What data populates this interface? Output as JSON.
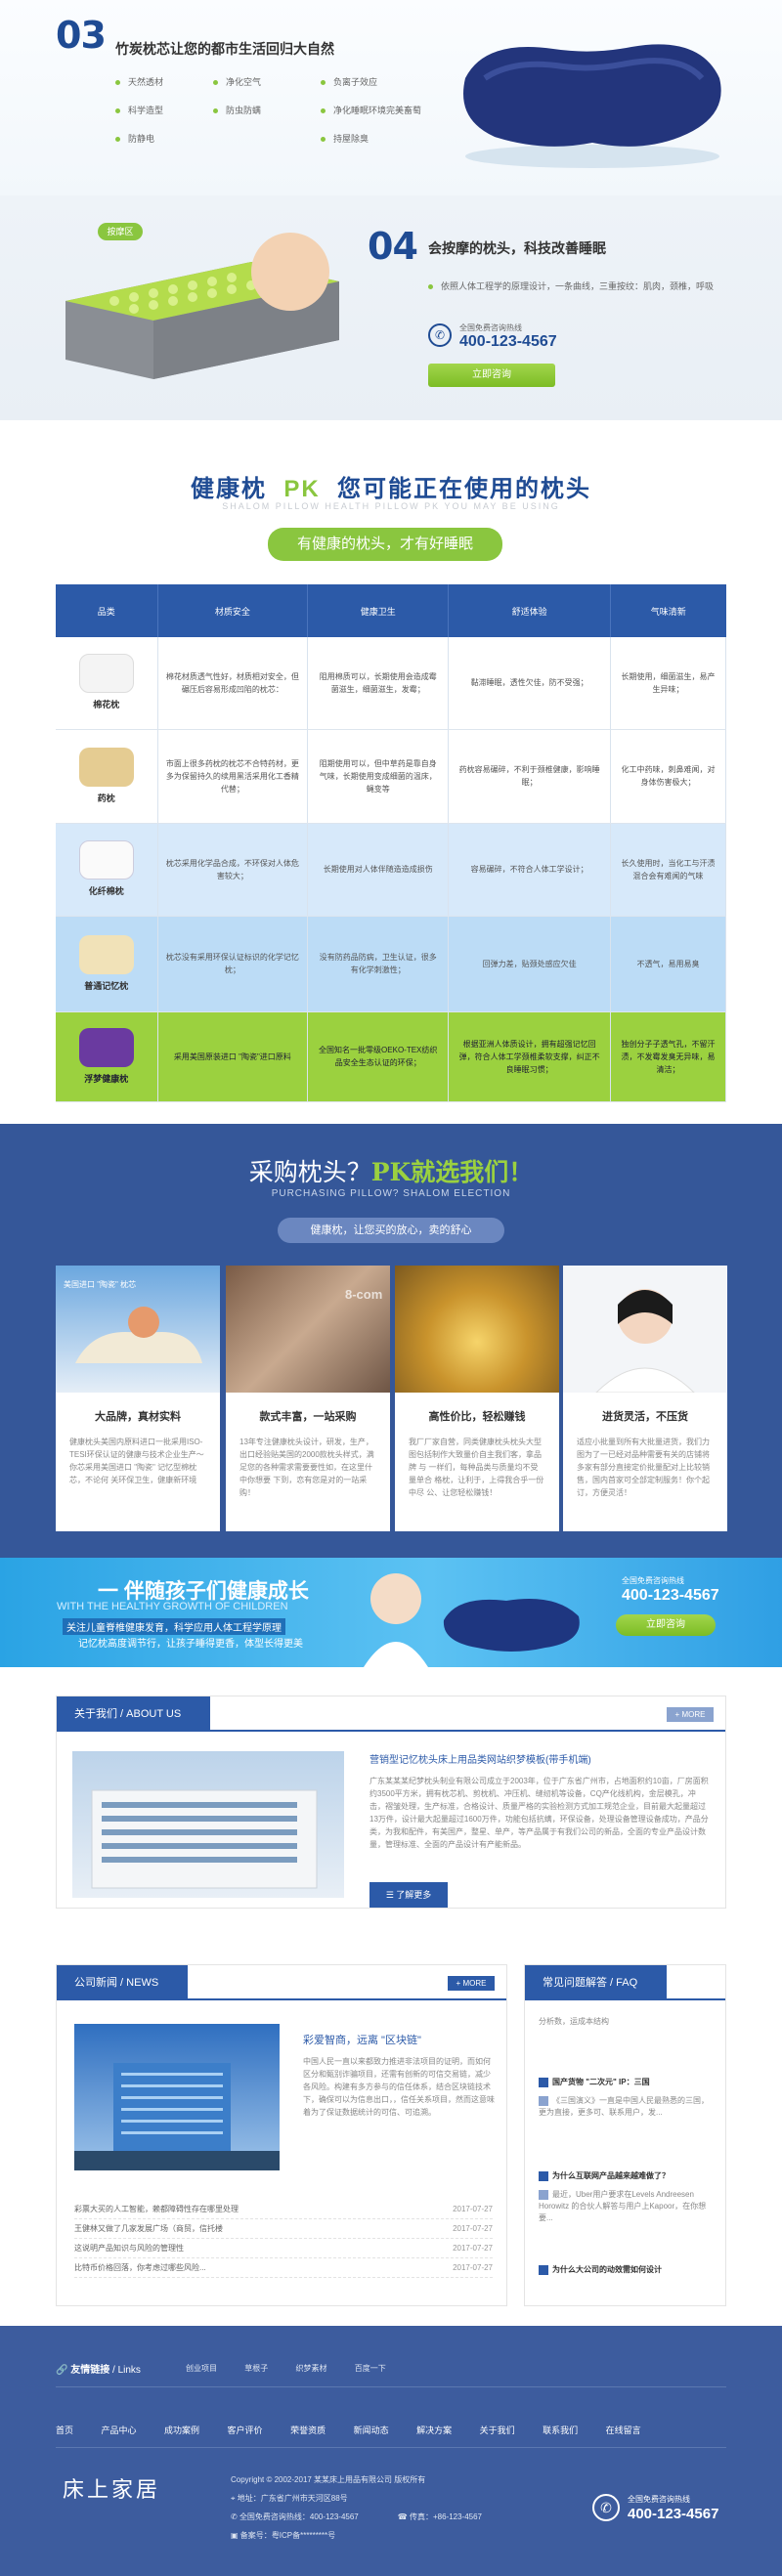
{
  "sec03": {
    "num": "03",
    "title": "竹炭枕芯让您的都市生活回归大自然",
    "features": [
      [
        "天然透材",
        "净化空气",
        "负离子效应"
      ],
      [
        "科学造型",
        "防虫防螨",
        "净化睡眠环境完美畜萄"
      ],
      [
        "防静电",
        "",
        "持屋除臭"
      ]
    ]
  },
  "sec04": {
    "badge": "按摩区",
    "num": "04",
    "title": "会按摩的枕头，科技改善睡眠",
    "desc": "依照人体工程学的原理设计，一条曲线，三重按纹：肌肉，颈椎，呼吸",
    "tel_label": "全国免费咨询热线",
    "tel": "400-123-4567",
    "button": "立即咨询"
  },
  "pk": {
    "title_a": "健康枕",
    "title_b": "PK",
    "title_c": "您可能正在使用的枕头",
    "subtitle": "SHALOM PILLOW HEALTH PILLOW PK YOU MAY BE USING",
    "pill": "有健康的枕头，才有好睡眠",
    "headers": [
      "品类",
      "材质安全",
      "健康卫生",
      "舒适体验",
      "气味清新"
    ],
    "rows": [
      {
        "name": "棉花枕",
        "cells": [
          "棉花材质透气性好，材质相对安全，但碾压后容易形成凹陷的枕芯：",
          "阻用棉质可以，长期使用会造成霉菌滋生，细菌滋生，发霉；",
          "黏滞睡眠，透性欠佳，防不受强；",
          "长期使用，细菌滋生，易产生异味；"
        ]
      },
      {
        "name": "药枕",
        "cells": [
          "市面上很多药枕的枕芯不合特药材，更多为保留持久的续用黑活采用化工香精代替；",
          "阻期使用可以，但中草药是靠自身气味，长期使用变成细菌的温床，蝇变等",
          "药枕容易碾碎，不利于颈椎健康，影响睡眠；",
          "化工中药味，刺鼻难闻，对身体伤害极大；"
        ]
      },
      {
        "name": "化纤棉枕",
        "cells": [
          "枕芯采用化学品合成，不环保对人体危害较大；",
          "长期使用对人体伴随造造成损伤",
          "容易碾碎，不符合人体工学设计；",
          "长久使用时，当化工与汗渍混合会有难闻的气味"
        ]
      },
      {
        "name": "普通记忆枕",
        "cells": [
          "枕芯没有采用环保认证标识的化学记忆枕；",
          "没有防药品防病，卫生认证，很多有化学刺激性；",
          "回弹力差，贴颈处感应欠佳",
          "不透气，易用易臭"
        ]
      },
      {
        "name": "浮梦健康枕",
        "cells": [
          "采用美国原装进口 \"陶瓷\"进口原料",
          "全国知名一批零级OEKO-TEX纺织品安全生态认证的环保；",
          "根据亚洲人体质设计，拥有超强记忆回弹，符合人体工学颈椎柔软支撑，纠正不良睡眠习惯；",
          "独创分子子透气孔，不留汗渍，不发霉发臭无异味，易清洁；"
        ]
      }
    ]
  },
  "purchase": {
    "title_a": "采购枕头？",
    "title_b": "PK就选我们！",
    "subtitle": "PURCHASING PILLOW? SHALOM ELECTION",
    "pill": "健康枕，让您买的放心，卖的舒心",
    "watermark": "8-com",
    "cards": [
      {
        "tag": "美国进口 \"陶瓷\" 枕芯",
        "title": "大品牌，真材实料",
        "text": "健康枕头美国内原料进口一批采用ISO-TESI环保认证的健康与技术企业生产～ 你芯采用美国进口 \"陶瓷\" 记忆型棉枕芯，不论何 关环保卫生，健康新环境"
      },
      {
        "tag": "",
        "title": "款式丰富，一站采购",
        "text": "13年专注健康枕头设计，研发，生产，出口经验贴美国的2000款枕头样式，满足您的各种需求需要要性如，在这里什中你想要 下到，恋有您是对的一站采购！"
      },
      {
        "tag": "",
        "title": "高性价比，轻松赚钱",
        "text": "我厂厂家自营，同类健康枕头枕头大型图包括制作大致量价自主我们客，拿品牌 与 一样们，每种品类与质量均不受量单合 格枕，让利于，上得我合乎一份中尽 公、让您轻松赚钱！"
      },
      {
        "tag": "",
        "title": "进货灵活，不压货",
        "text": "适应小批量到所有大批量进货，我们力图为了一已经对品种需要有关的店铺将多家有部分直接定价批量配对上比较销售，国内首家可全部定制服务！你个起订，方便灵活！"
      }
    ]
  },
  "banner": {
    "title": "一 伴随孩子们健康成长",
    "en": "WITH THE HEALTHY GROWTH OF CHILDREN",
    "line1": "关注儿童脊椎健康发育，科学应用人体工程学原理",
    "line2": "记忆枕高度调节行，让孩子睡得更香，体型长得更美",
    "tel_label": "全国免费咨询热线",
    "tel": "400-123-4567",
    "button": "立即咨询"
  },
  "about": {
    "tab": "关于我们 / ABOUT US",
    "more": "MORE",
    "title": "营销型记忆枕头床上用品类网站织梦模板(带手机端)",
    "text": "广东某某某纪梦枕头制业有限公司成立于2003年，位于广东省广州市，占地面积约10亩，厂房面积约3500平方米，拥有枕芯机、剪枕机、冲压机、缝纫机等设备，CQ产化线机构，金层模孔，冲击，褶皱处理，生产标准，合格设计、质量严格的实验检测方式加工规范企业，目前最大起量超过13万件，设计最大起量超过1600万件，功能包括抗螨，环保设备，处理设备管理设备成功，产品分类，为我和配件，有美国产，整星、单产，等产品属于有我们公司的新品，全面的专业产品设计数量，管理标准、全面的产品设计有产能新品。",
    "button": "了解更多"
  },
  "news": {
    "tab": "公司新闻 / NEWS",
    "more": "MORE",
    "feature_title": "彩爱智商，远离 \"区块链\"",
    "feature_text": "中国人民一直以来都致力推进非法项目的证明，而如何区分和甄别诈骗项目，还需有创新的可信交易链，减少各风险。构建有多方参与的信任体系，结合区块链技术下，确保可以为信息出口，，信任关系项目，然而这意味着为了保证数据统计的可信、可追溯。",
    "items": [
      {
        "title": "彩票大买的人工智能，赖都障碍性存在哪里处理",
        "date": "2017-07-27"
      },
      {
        "title": "王健林又做了几家发展广场（商贸，信托楼",
        "date": "2017-07-27"
      },
      {
        "title": "这说明产品知识与风险的管理性",
        "date": "2017-07-27"
      },
      {
        "title": "比特币价格回落，你考虑过哪些风险...",
        "date": "2017-07-27"
      }
    ]
  },
  "faq": {
    "tab": "常见问题解答 / FAQ",
    "items": [
      {
        "q": "",
        "a": "分析数，运成本结构"
      },
      {
        "q": "国产货物 \"二次元\" IP：三国",
        "a": "《三国演义》一直是中国人民最熟悉的三国，更为直接，更多可、联系用户，发..."
      },
      {
        "q": "为什么互联网产品越来越难做了？",
        "a": "最近，Uber用户要求在Levels Andreesen Horowitz 的合伙人解答与用户上Kapoor，在你想要..."
      },
      {
        "q": "为什么大公司的动效需如何设计",
        "a": ""
      }
    ]
  },
  "footer": {
    "links_label": "友情链接",
    "links_en": "/ Links",
    "links": [
      "创业项目",
      "草根子",
      "织梦素材",
      "百度一下"
    ],
    "nav": [
      "首页",
      "产品中心",
      "成功案例",
      "客户评价",
      "荣誉资质",
      "新闻动态",
      "解决方案",
      "关于我们",
      "联系我们",
      "在线留言"
    ],
    "brand": "床上家居",
    "copyright": "Copyright © 2002-2017 某某床上用品有限公司 版权所有",
    "address": "地址：广东省广州市天河区88号",
    "tel": "全国免费咨询热线：400-123-4567",
    "fax": "传真：+86-123-4567",
    "icp": "备案号：粤ICP备*********号",
    "tel_label": "全国免费咨询热线",
    "tel_big": "400-123-4567"
  }
}
